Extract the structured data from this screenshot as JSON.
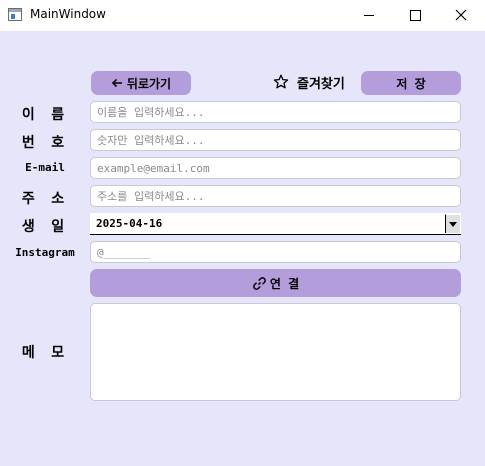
{
  "window": {
    "title": "MainWindow"
  },
  "toolbar": {
    "back_label": "뒤로가기",
    "favorite_label": "즐겨찾기",
    "save_label": "저 장"
  },
  "form": {
    "name_label": "이 름",
    "name_placeholder": "이름을 입력하세요...",
    "phone_label": "번 호",
    "phone_placeholder": "숫자만 입력하세요...",
    "email_label": "E-mail",
    "email_placeholder": "example@email.com",
    "address_label": "주 소",
    "address_placeholder": "주소를 입력하세요...",
    "birthday_label": "생 일",
    "birthday_value": "2025-04-16",
    "instagram_label": "Instagram",
    "instagram_placeholder": "@_______",
    "link_label": "연 결",
    "memo_label": "메 모",
    "memo_value": ""
  },
  "colors": {
    "background": "#e6e6fa",
    "accent": "#b39ddb"
  },
  "icons": {
    "back": "arrow-left-icon",
    "favorite": "star-outline-icon",
    "link": "link-icon",
    "dropdown": "chevron-down-icon"
  }
}
